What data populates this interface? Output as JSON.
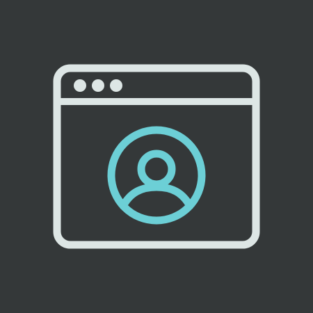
{
  "icon": {
    "name": "browser-window-user-profile-icon",
    "colors": {
      "background": "#343839",
      "window_stroke": "#DDE6E5",
      "accent": "#6CCFD6"
    },
    "window_controls": [
      "dot",
      "dot",
      "dot"
    ]
  }
}
